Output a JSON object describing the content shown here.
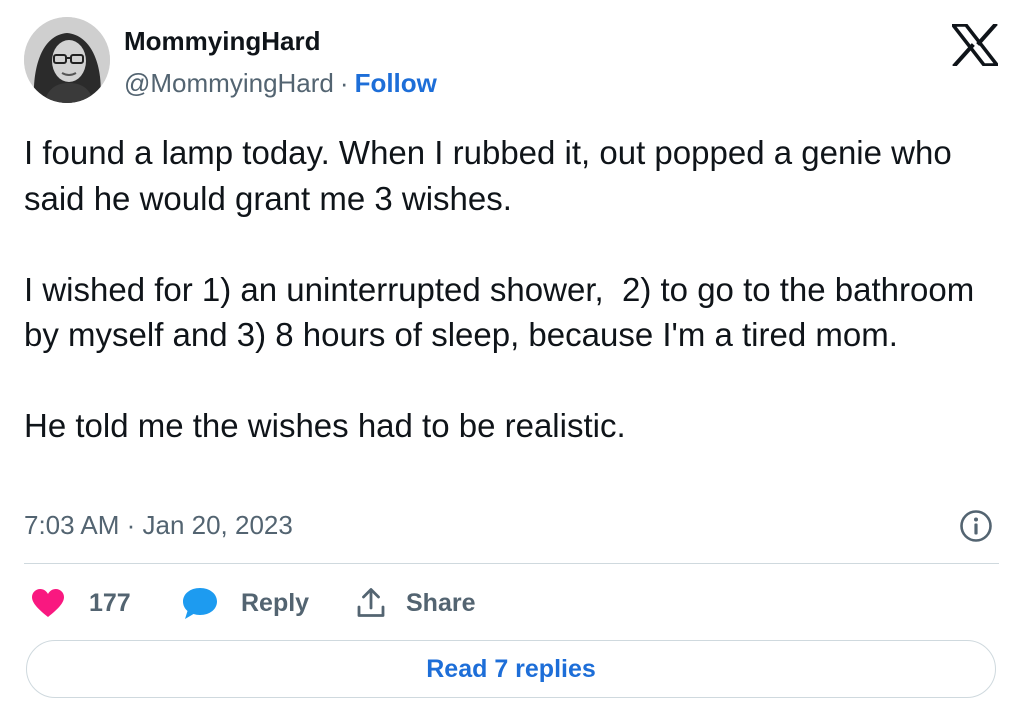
{
  "author": {
    "display_name": "MommyingHard",
    "handle": "@MommyingHard",
    "separator": "·",
    "follow_label": "Follow"
  },
  "tweet": {
    "text": "I found a lamp today. When I rubbed it, out popped a genie who said he would grant me 3 wishes.\n\nI wished for 1) an uninterrupted shower,  2) to go to the bathroom by myself and 3) 8 hours of sleep, because I'm a tired mom.\n\nHe told me the wishes had to be realistic.",
    "timestamp": "7:03 AM · Jan 20, 2023"
  },
  "actions": {
    "like_count": "177",
    "reply_label": "Reply",
    "share_label": "Share"
  },
  "read_replies_label": "Read 7 replies",
  "icons": {
    "brand": "x-logo-icon",
    "info": "info-icon",
    "like": "heart-icon",
    "reply": "speech-bubble-icon",
    "share": "share-upload-icon"
  },
  "colors": {
    "accent": "#1d6ed8",
    "heart": "#f91880",
    "reply_bubble": "#1d9bf0",
    "secondary_text": "#536471",
    "border": "#cfd9de"
  }
}
